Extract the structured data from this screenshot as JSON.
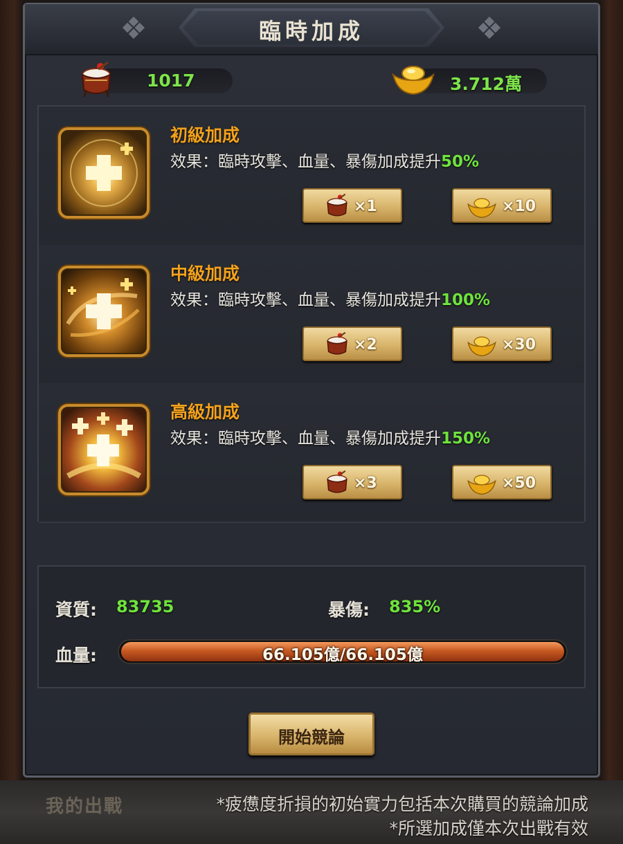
{
  "title": "臨時加成",
  "resources": {
    "drum_count": "1017",
    "gold_amount": "3.712萬"
  },
  "boosts": [
    {
      "name": "初級加成",
      "effect_prefix": "效果：臨時攻擊、血量、暴傷加成提升",
      "effect_value": "50%",
      "drum_cost": "×1",
      "gold_cost": "×10",
      "icon": "heal-plus-icon"
    },
    {
      "name": "中級加成",
      "effect_prefix": "效果：臨時攻擊、血量、暴傷加成提升",
      "effect_value": "100%",
      "drum_cost": "×2",
      "gold_cost": "×30",
      "icon": "heal-swirl-icon"
    },
    {
      "name": "高級加成",
      "effect_prefix": "效果：臨時攻擊、血量、暴傷加成提升",
      "effect_value": "150%",
      "drum_cost": "×3",
      "gold_cost": "×50",
      "icon": "heal-burst-icon"
    }
  ],
  "stats": {
    "quality_label": "資質:",
    "quality_value": "83735",
    "crit_label": "暴傷:",
    "crit_value": "835%",
    "hp_label": "血量:",
    "hp_text": "66.105億/66.105億",
    "hp_fraction": 1.0
  },
  "start_button": "開始競論",
  "bottom": {
    "title": "我的出戰",
    "note1": "*疲憊度折損的初始實力包括本次購買的競論加成",
    "note2": "*所選加成僅本次出戰有效"
  },
  "colors": {
    "accent_orange": "#f4a21c",
    "value_green": "#6ee33c",
    "gold_button": "#d8b46a"
  }
}
